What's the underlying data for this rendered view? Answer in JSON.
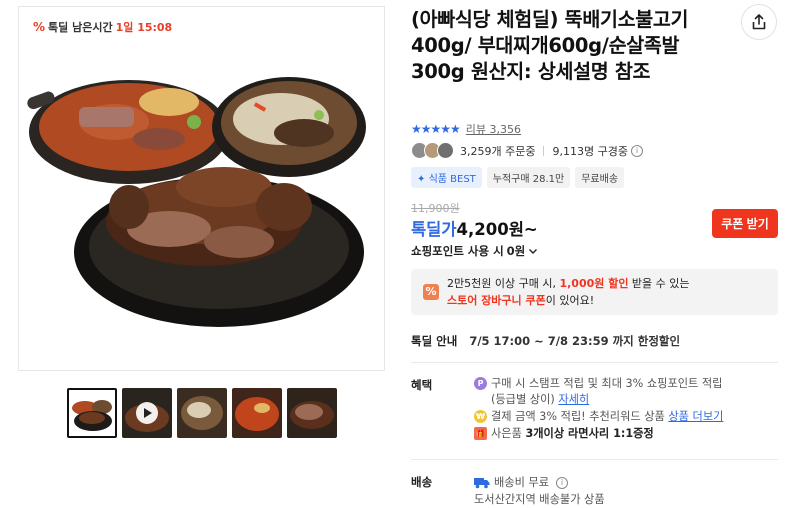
{
  "image": {
    "timer_icon": "percent-icon",
    "timer_label": "톡딜 남은시간",
    "timer_value": "1일 15:08",
    "thumbnails": [
      "thumb-1",
      "thumb-2-video",
      "thumb-3",
      "thumb-4",
      "thumb-5"
    ]
  },
  "product": {
    "title": "(아빠식당 체험딜) 뚝배기소불고기400g/ 부대찌개600g/순살족발300g 원산지: 상세설명 참조",
    "rating_stars": "★★★★★",
    "review_label": "리뷰",
    "review_count": "3,356",
    "orders": "3,259개 주문중",
    "subscribers": "9,113명 구경중",
    "badges": [
      "식품 BEST",
      "누적구매 28.1만",
      "무료배송"
    ],
    "original_price": "11,900원",
    "price_prefix": "톡딜가",
    "price": "4,200원~",
    "coupon_button": "쿠폰 받기",
    "points_label": "쇼핑포인트 사용 시",
    "points_value": "0원",
    "promo_line1_pre": "2만5천원 이상 구매 시, ",
    "promo_line1_hl": "1,000원 할인",
    "promo_line1_post": " 받을 수 있는",
    "promo_line2_hl": "스토어 장바구니 쿠폰",
    "promo_line2_post": "이 있어요!",
    "deal_label": "톡딜 안내",
    "deal_value": "7/5 17:00 ~ 7/8 23:59 까지 한정할인",
    "benefit_label": "혜택",
    "benefit1_line1": "구매 시 스탬프 적립 및 최대 3% 쇼핑포인트 적립",
    "benefit1_line2": "(등급별 상이)",
    "benefit1_link": "자세히",
    "benefit2_text": "결제 금액 3% 적립! 추천리워드 상품",
    "benefit2_link": "상품 더보기",
    "benefit3_pre": "사은품",
    "benefit3_strong": "3개이상 라면사리 1:1증정",
    "shipping_label": "배송",
    "shipping_value": "배송비 무료",
    "shipping_sub": "도서산간지역 배송불가 상품"
  },
  "colors": {
    "accent_blue": "#2f6ae0",
    "accent_red": "#f0351f"
  }
}
